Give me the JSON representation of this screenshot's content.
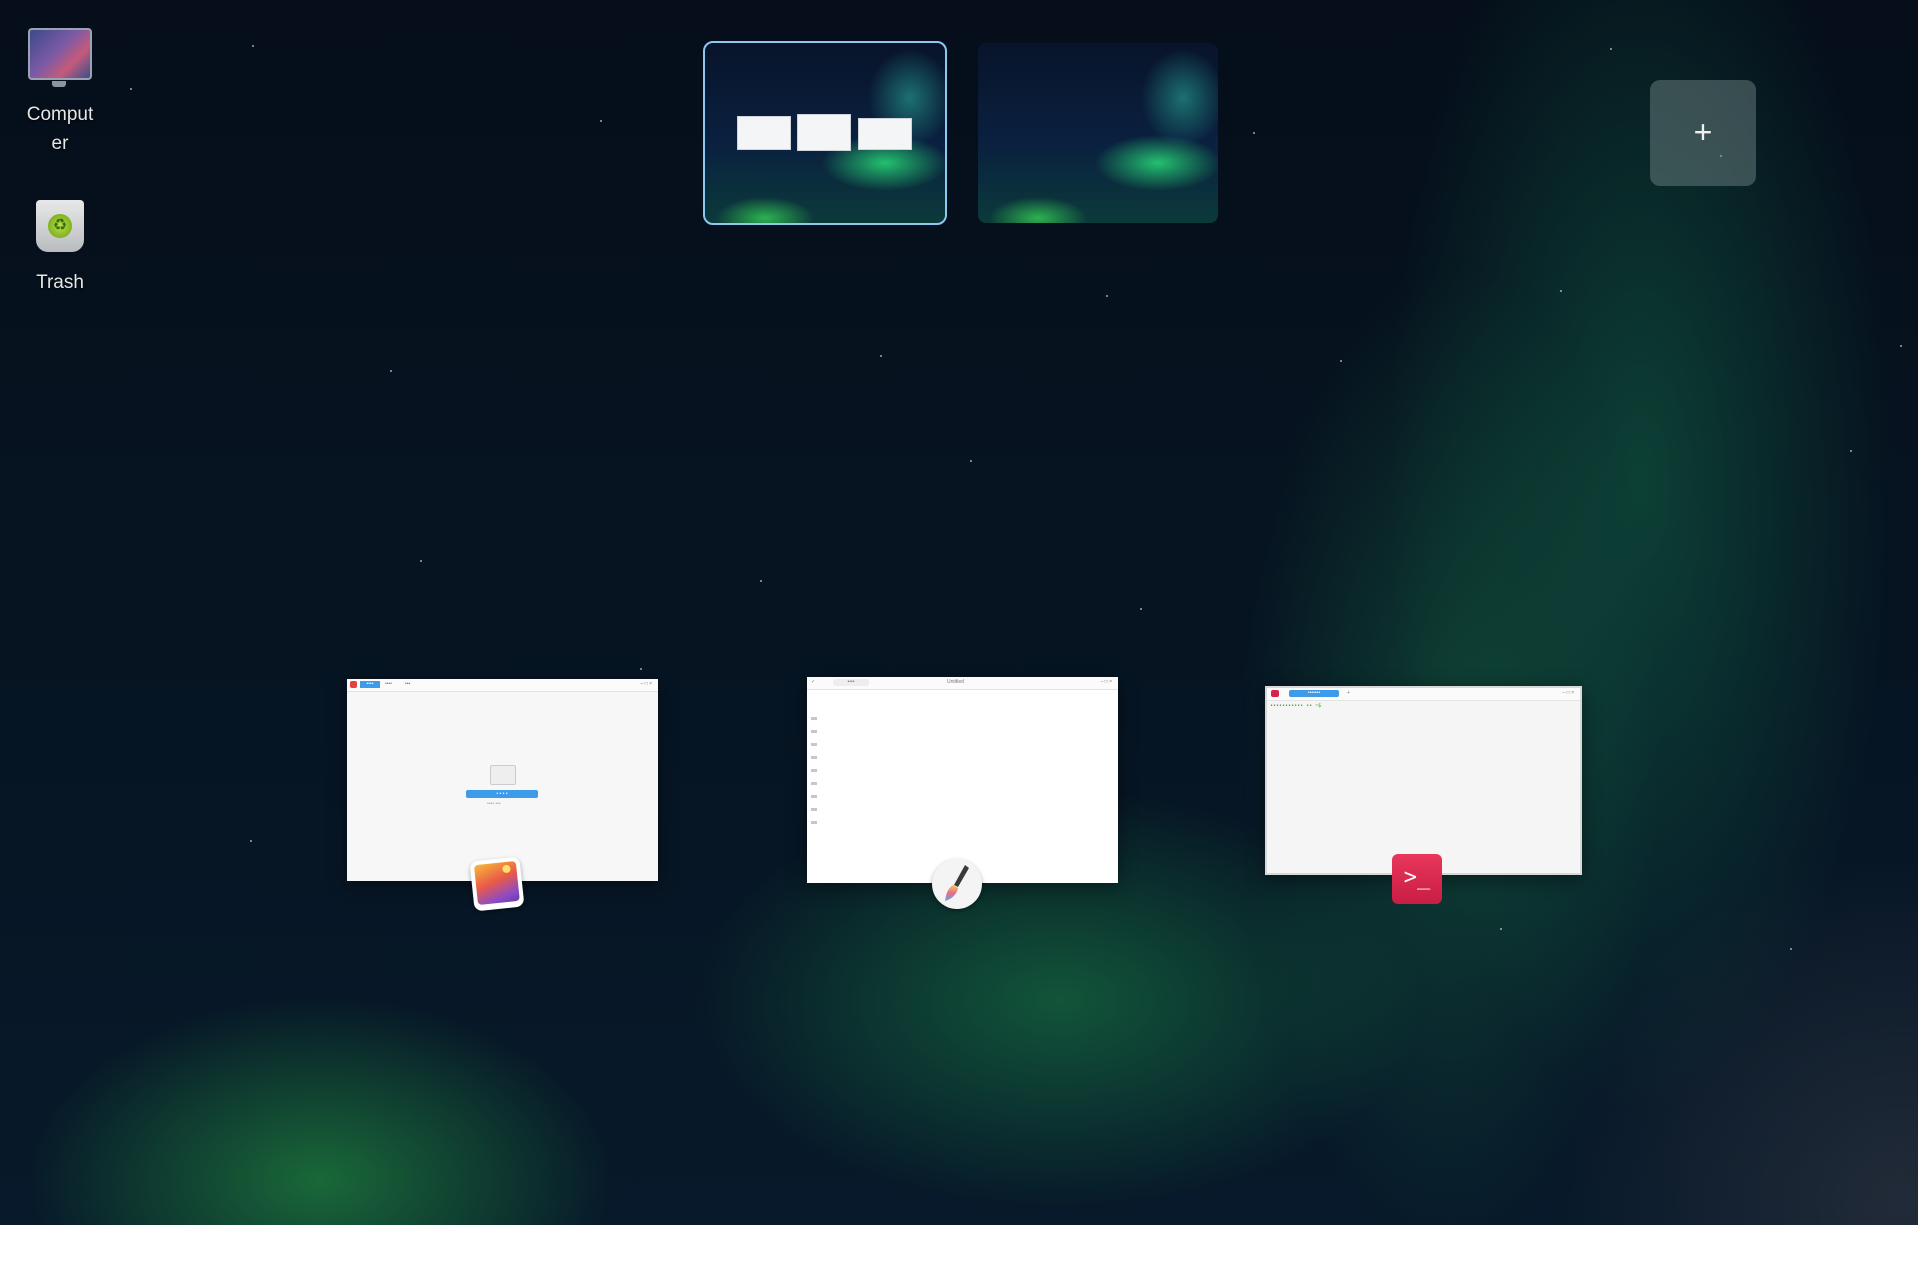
{
  "desktop": {
    "icons": [
      {
        "label": "Comput\ner",
        "icon": "computer-icon"
      },
      {
        "label": "Trash",
        "icon": "trash-icon"
      }
    ]
  },
  "workspaces": {
    "items": [
      {
        "active": true,
        "mini_windows": 3
      },
      {
        "active": false,
        "mini_windows": 0
      }
    ],
    "add_label": "+"
  },
  "windows": [
    {
      "app": "image-viewer",
      "icon": "image-viewer-icon",
      "tabs": [
        "••••",
        "••••",
        "•••"
      ],
      "button_label": "• • • •",
      "hint": "•••• •••"
    },
    {
      "app": "draw",
      "icon": "paint-brush-icon",
      "zoom": "••••",
      "title": "Untitled"
    },
    {
      "app": "terminal",
      "icon": "terminal-icon",
      "tab": "•••••••",
      "prompt": "••••••••••• •• ~$",
      "badge_label": ">_"
    }
  ],
  "colors": {
    "accent": "#3d9be9",
    "terminal_accent": "#d7234c",
    "active_workspace_border": "#8ec8ee"
  }
}
